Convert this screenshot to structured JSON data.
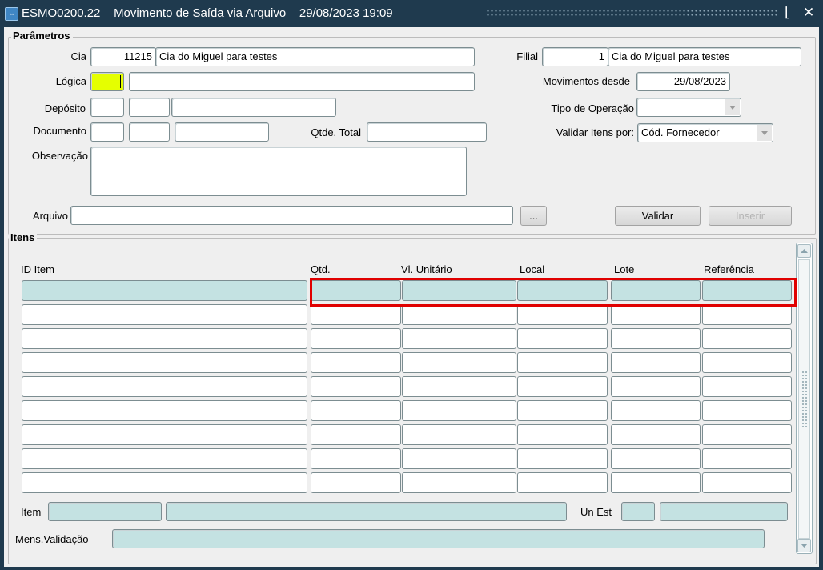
{
  "window": {
    "title": "ESMO0200.22    Movimento de Saída via Arquivo    29/08/2023 19:09",
    "controls": {
      "minimize": "⌊",
      "close": "✕"
    }
  },
  "parametros": {
    "legend": "Parâmetros",
    "cia": {
      "label": "Cia",
      "code": "11215",
      "name": "Cia do Miguel para testes"
    },
    "filial": {
      "label": "Filial",
      "code": "1",
      "name": "Cia do Miguel para testes"
    },
    "logica": {
      "label": "Lógica",
      "code": "",
      "desc": ""
    },
    "movimentos_desde": {
      "label": "Movimentos desde",
      "value": "29/08/2023"
    },
    "deposito": {
      "label": "Depósito"
    },
    "tipo_operacao": {
      "label": "Tipo de Operação",
      "value": ""
    },
    "documento": {
      "label": "Documento"
    },
    "qtde_total": {
      "label": "Qtde. Total",
      "value": ""
    },
    "validar_itens": {
      "label": "Validar Itens por:",
      "value": "Cód. Fornecedor"
    },
    "observacao": {
      "label": "Observação",
      "value": ""
    },
    "arquivo": {
      "label": "Arquivo",
      "value": "",
      "browse_label": "..."
    },
    "buttons": {
      "validar": "Validar",
      "inserir": "Inserir"
    }
  },
  "itens": {
    "legend": "Itens",
    "columns": [
      "ID Item",
      "Qtd.",
      "Vl. Unitário",
      "Local",
      "Lote",
      "Referência"
    ],
    "rows": 9,
    "footer": {
      "item_label": "Item",
      "un_est_label": "Un Est",
      "mens_label": "Mens.Validação"
    }
  },
  "colors": {
    "titlebar": "#1f3a4e",
    "readonly_field": "#c4e2e2",
    "required_field": "#e5ff00",
    "highlight": "#e00000"
  }
}
